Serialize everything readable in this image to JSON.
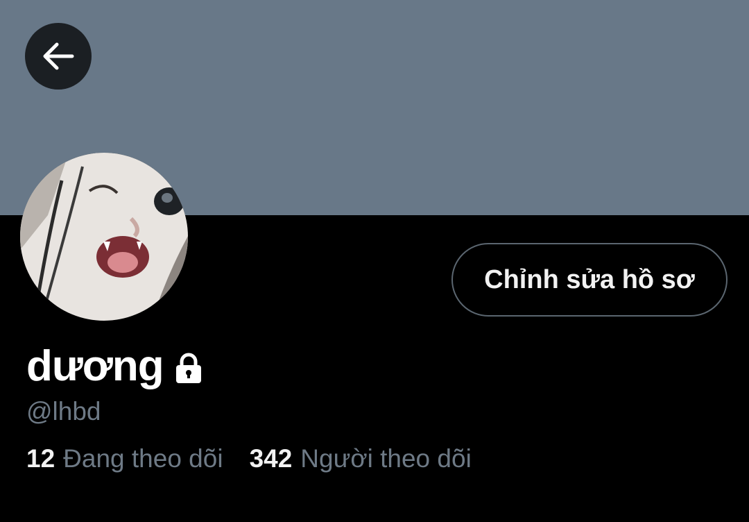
{
  "profile": {
    "display_name": "dương",
    "handle": "@lhbd",
    "edit_profile_label": "Chỉnh sửa hồ sơ"
  },
  "stats": {
    "following_count": "12",
    "following_label": "Đang theo dõi",
    "followers_count": "342",
    "followers_label": "Người theo dõi"
  },
  "icons": {
    "back": "arrow-left-icon",
    "protected": "lock-icon"
  },
  "colors": {
    "banner": "#687888",
    "background": "#000000",
    "muted_text": "#6e7a86",
    "button_border": "#5b6670"
  }
}
